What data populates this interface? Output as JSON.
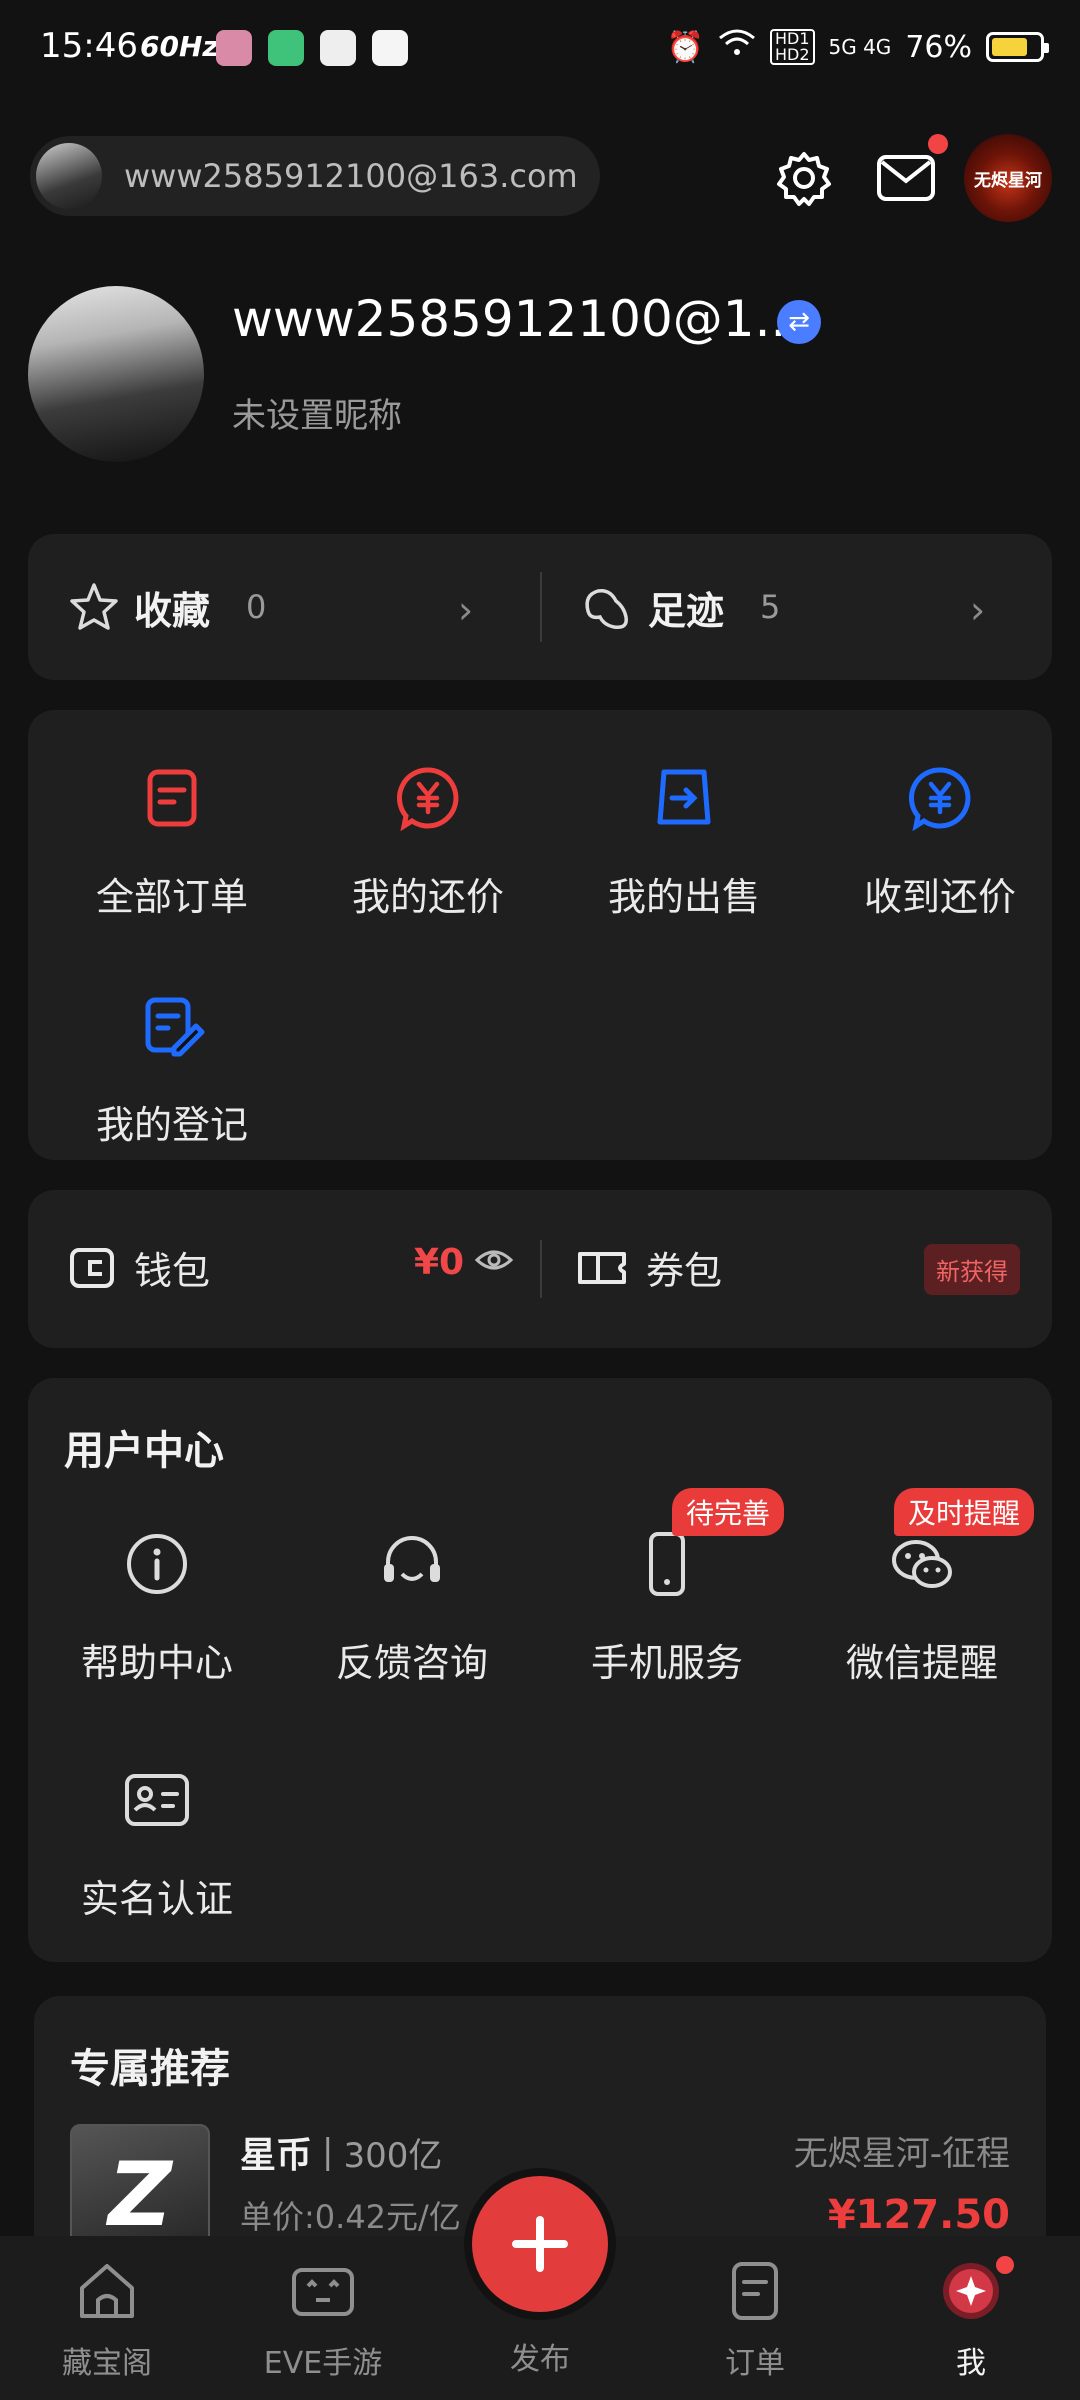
{
  "status_bar": {
    "time": "15:46",
    "refresh": "60Hz",
    "network": "5G 4G",
    "battery": "76%",
    "battery_level": 0.76
  },
  "header": {
    "account_email": "www2585912100@163.com",
    "game_logo_text": "无烬星河"
  },
  "profile": {
    "name": "www2585912100@1...",
    "nickname": "未设置昵称"
  },
  "favorites": [
    {
      "label": "收藏",
      "count": "0"
    },
    {
      "label": "足迹",
      "count": "5"
    }
  ],
  "orders": [
    {
      "label": "全部订单",
      "icon": "order-list-icon"
    },
    {
      "label": "我的还价",
      "icon": "yuan-bubble-icon"
    },
    {
      "label": "我的出售",
      "icon": "sell-arrow-icon"
    },
    {
      "label": "收到还价",
      "icon": "yuan-received-icon"
    },
    {
      "label": "我的登记",
      "icon": "register-edit-icon"
    }
  ],
  "wallet": {
    "wallet_label": "钱包",
    "balance": "¥0",
    "coupon_label": "券包",
    "coupon_tag": "新获得"
  },
  "user_center": {
    "title": "用户中心",
    "items": [
      {
        "label": "帮助中心",
        "icon": "info-icon",
        "badge": ""
      },
      {
        "label": "反馈咨询",
        "icon": "headset-icon",
        "badge": ""
      },
      {
        "label": "手机服务",
        "icon": "phone-icon",
        "badge": "待完善"
      },
      {
        "label": "微信提醒",
        "icon": "wechat-icon",
        "badge": "及时提醒"
      },
      {
        "label": "实名认证",
        "icon": "id-card-icon",
        "badge": ""
      }
    ]
  },
  "recommend": {
    "title": "专属推荐",
    "item_name": "星币",
    "item_qty": "300亿",
    "unit_price": "单价:0.42元/亿",
    "server": "无烬星河-征程",
    "price": "¥127.50"
  },
  "bottom_nav": [
    {
      "label": "藏宝阁"
    },
    {
      "label": "EVE手游"
    },
    {
      "label": "发布"
    },
    {
      "label": "订单"
    },
    {
      "label": "我"
    }
  ],
  "colors": {
    "accent_red": "#e23c3c",
    "accent_blue": "#1f6bff",
    "background": "#121212",
    "card": "#1f1f1f"
  }
}
